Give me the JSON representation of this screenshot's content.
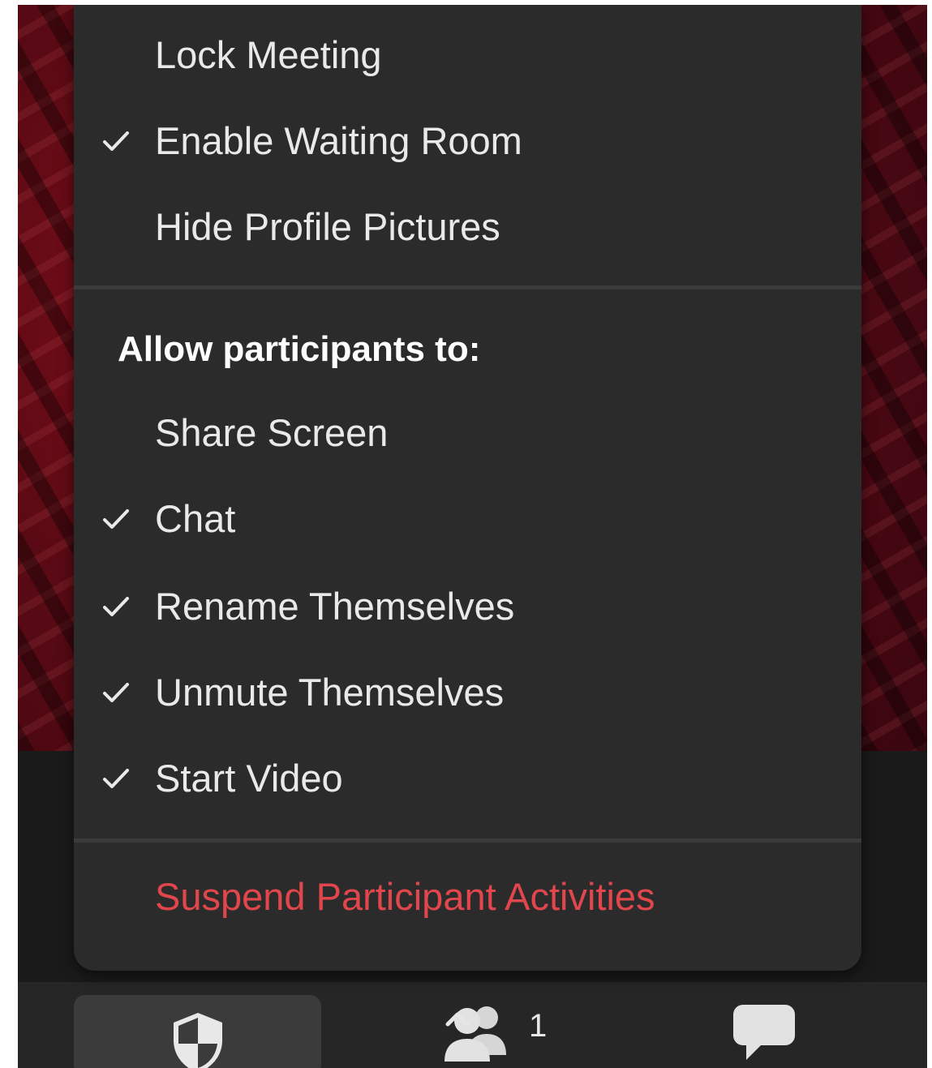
{
  "security_menu": {
    "meeting_items": [
      {
        "label": "Lock Meeting",
        "checked": false
      },
      {
        "label": "Enable Waiting Room",
        "checked": true
      },
      {
        "label": "Hide Profile Pictures",
        "checked": false
      }
    ],
    "allow_header": "Allow participants to:",
    "allow_items": [
      {
        "label": "Share Screen",
        "checked": false
      },
      {
        "label": "Chat",
        "checked": true
      },
      {
        "label": "Rename Themselves",
        "checked": true
      },
      {
        "label": "Unmute Themselves",
        "checked": true
      },
      {
        "label": "Start Video",
        "checked": true
      }
    ],
    "suspend_label": "Suspend Participant Activities",
    "suspend_color": "#e0464c"
  },
  "toolbar": {
    "security_icon": "shield-icon",
    "participants_icon": "participants-icon",
    "participants_count": "1",
    "caret_icon": "chevron-up-icon",
    "chat_icon": "chat-bubble-icon"
  }
}
